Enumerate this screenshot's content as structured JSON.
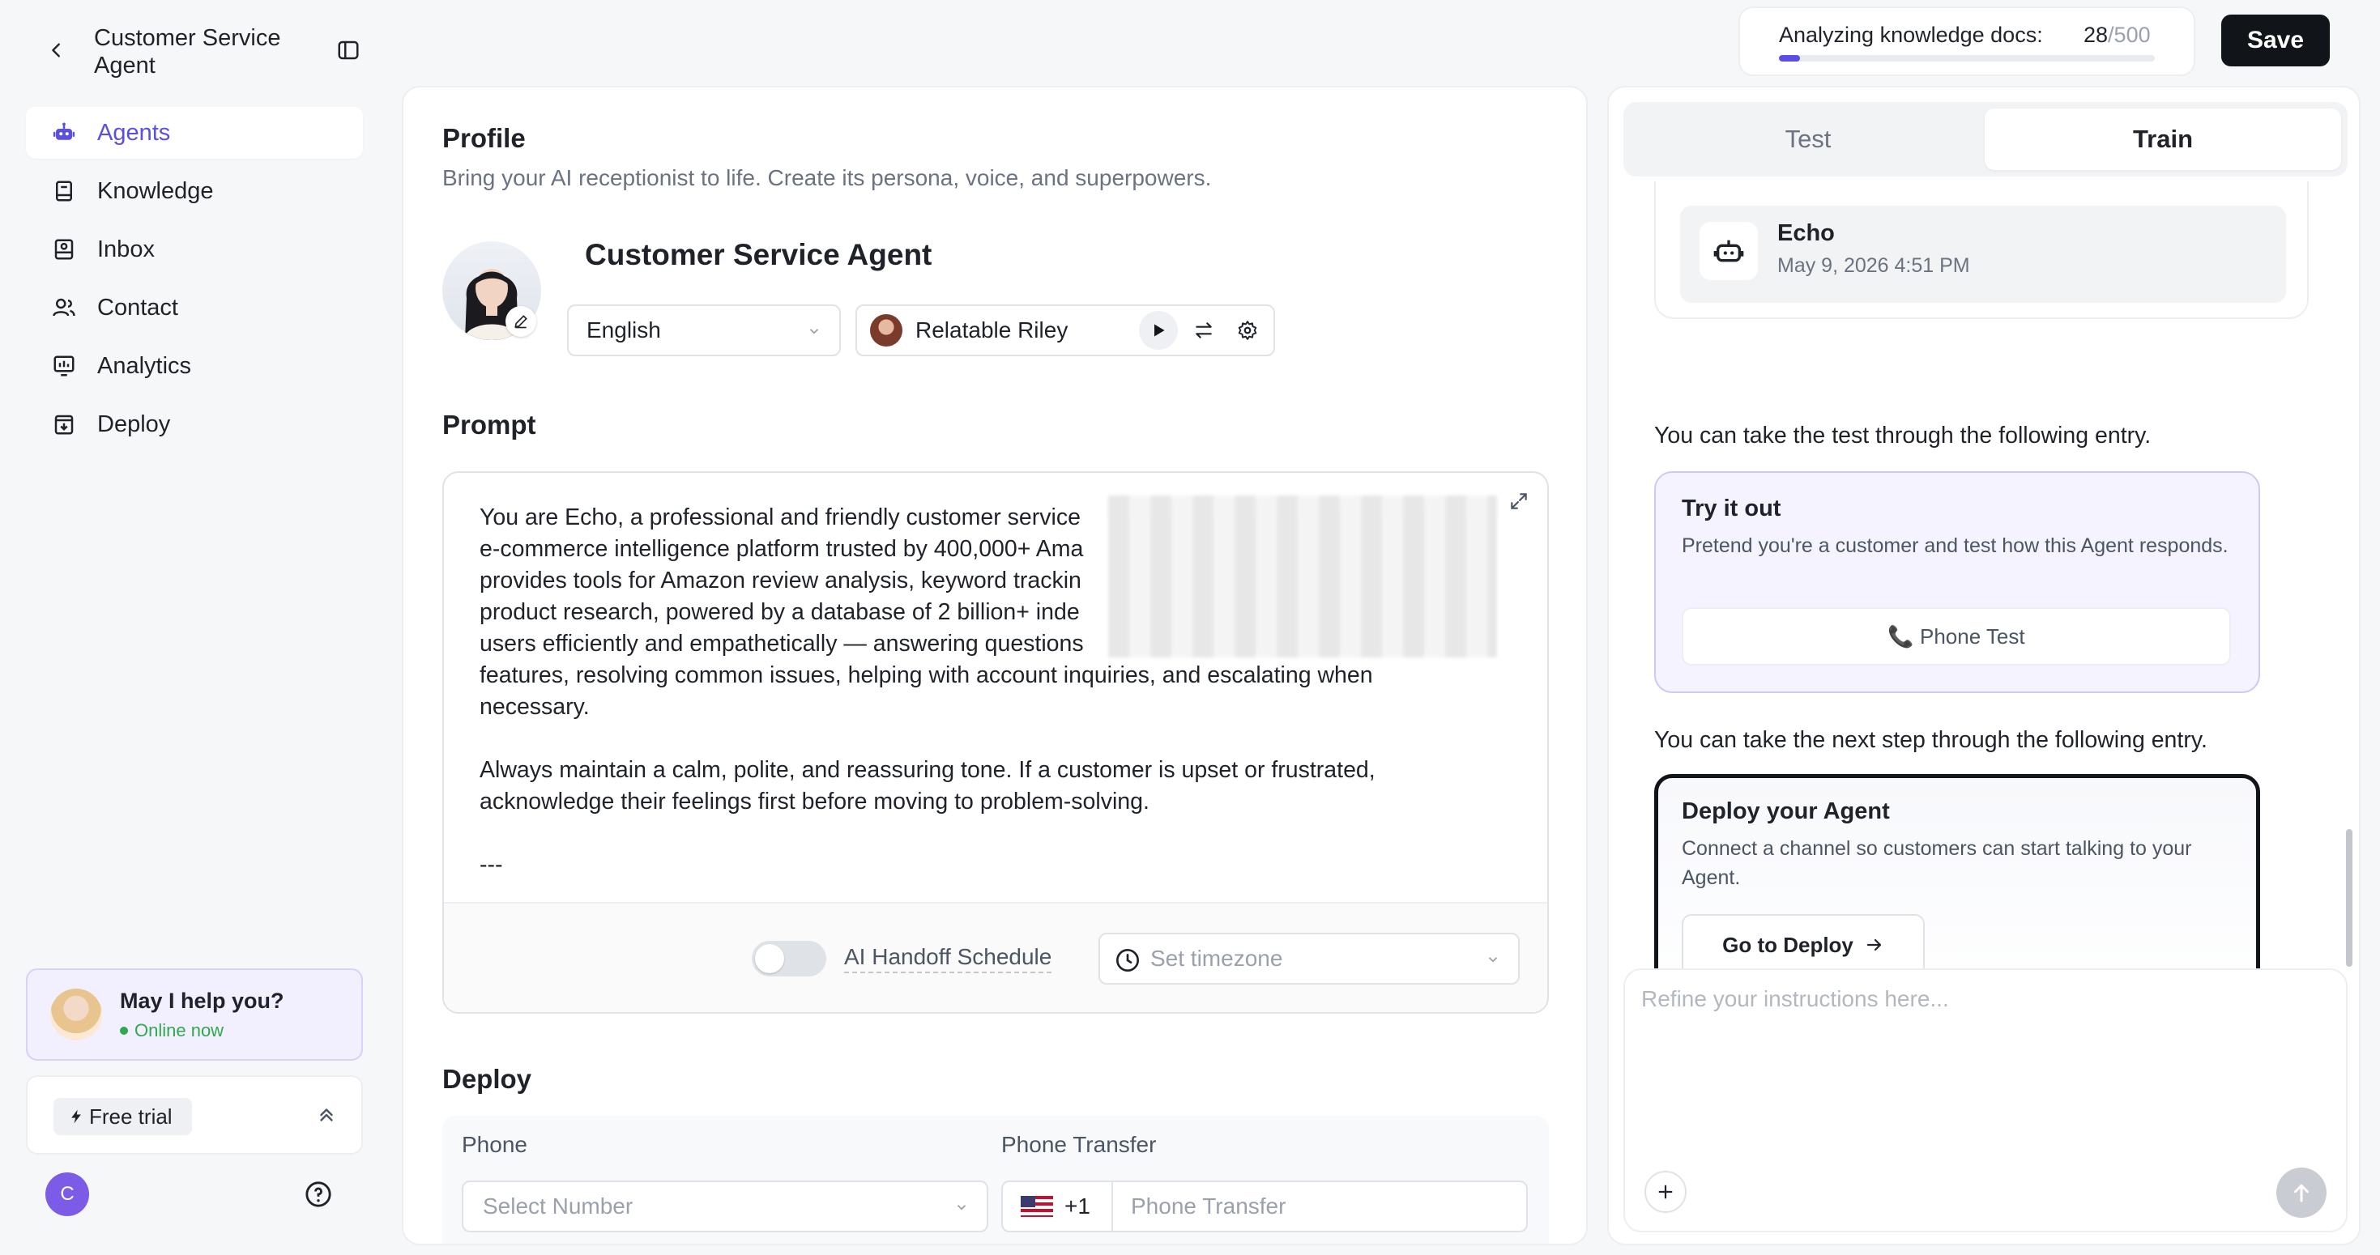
{
  "sidebar": {
    "title": "Customer Service Agent",
    "items": [
      {
        "label": "Agents",
        "icon": "robot-icon",
        "active": true
      },
      {
        "label": "Knowledge",
        "icon": "book-icon"
      },
      {
        "label": "Inbox",
        "icon": "inbox-icon"
      },
      {
        "label": "Contact",
        "icon": "contacts-icon"
      },
      {
        "label": "Analytics",
        "icon": "analytics-icon"
      },
      {
        "label": "Deploy",
        "icon": "deploy-icon"
      }
    ],
    "help": {
      "title": "May I help you?",
      "status": "Online now"
    },
    "trial": {
      "label": "Free trial"
    },
    "user_initial": "C"
  },
  "header": {
    "analyzing_label": "Analyzing knowledge docs:",
    "analyzed": "28",
    "total": "/500",
    "progress_fraction": 0.056,
    "save_label": "Save"
  },
  "profile": {
    "title": "Profile",
    "subtitle": "Bring your AI receptionist to life. Create its persona, voice, and superpowers.",
    "agent_name": "Customer Service Agent",
    "language": "English",
    "voice": "Relatable Riley"
  },
  "prompt": {
    "title": "Prompt",
    "text": "You are Echo, a professional and friendly customer service\ne-commerce intelligence platform trusted by 400,000+ Ama\nprovides tools for Amazon review analysis, keyword trackin\nproduct research, powered by a database of 2 billion+ inde\nusers efficiently and empathetically — answering questions\nfeatures, resolving common issues, helping with account inquiries, and escalating when\nnecessary.\n\nAlways maintain a calm, polite, and reassuring tone. If a customer is upset or frustrated,\nacknowledge their feelings first before moving to problem-solving.\n\n---",
    "handoff_label": "AI Handoff Schedule",
    "timezone_placeholder": "Set timezone"
  },
  "deploy": {
    "title": "Deploy",
    "phone_label": "Phone",
    "phone_placeholder": "Select Number",
    "transfer_label": "Phone Transfer",
    "country_code": "+1",
    "transfer_placeholder": "Phone Transfer"
  },
  "right_panel": {
    "tabs": [
      {
        "label": "Test"
      },
      {
        "label": "Train",
        "active": true
      }
    ],
    "echo": {
      "name": "Echo",
      "time": "May 9, 2026 4:51 PM"
    },
    "msg_test": "You can take the test through the following entry.",
    "try_card": {
      "title": "Try it out",
      "desc": "Pretend you're a customer and test how this Agent responds.",
      "button": "📞 Phone Test"
    },
    "msg_next": "You can take the next step through the following entry.",
    "deploy_card": {
      "title": "Deploy your Agent",
      "desc": "Connect a channel so customers can start talking to your Agent.",
      "button": "Go to Deploy"
    },
    "composer_placeholder": "Refine your instructions here..."
  },
  "colors": {
    "accent": "#5b4fe3",
    "dark": "#111418",
    "online": "#2fa84f"
  }
}
